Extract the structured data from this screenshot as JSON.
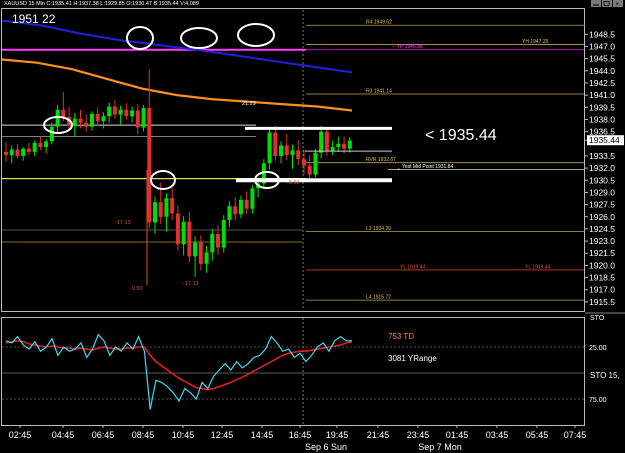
{
  "header": {
    "symbol_line": "XAUUSD 15 Min C:1935.41 H:1937.38 L:1929.85 O:1930.47 B:1935.44 V:4,089",
    "timer": "1951 22"
  },
  "window_controls": [
    "minimize",
    "restore",
    "close"
  ],
  "annotation": {
    "price_text": "< 1935.44"
  },
  "levels": [
    {
      "label": "R4 1949.62",
      "value": 1949.62,
      "color": "#e0c060"
    },
    {
      "label": "YH 1947.25",
      "value": 1947.25,
      "color": "#e0c060"
    },
    {
      "label": "-- YP 1946.88",
      "value": 1946.6,
      "color": "#ff40ff"
    },
    {
      "label": "R3 1941.14",
      "value": 1941.14,
      "color": "#e0c060"
    },
    {
      "label": "RVR 1932.67",
      "value": 1932.67,
      "color": "#e0c060"
    },
    {
      "label": "Yest Mid Point 1931.84",
      "value": 1931.84,
      "color": "#ffffff"
    },
    {
      "label": "L3 1924.20",
      "value": 1924.2,
      "color": "#e0c060"
    },
    {
      "label": "YL 1919.44",
      "value": 1919.44,
      "color": "#e05030"
    },
    {
      "label": "L4 1915.72",
      "value": 1915.72,
      "color": "#e0c060"
    }
  ],
  "candle_labels": [
    "21.29",
    "-17.13",
    "-9.50",
    "-17.13",
    "-8.62"
  ],
  "indicator_labels": {
    "td": "753 TD",
    "yrange": "3081 YRange",
    "sto_short": "STO",
    "sto_long": "STO 15,"
  },
  "colors": {
    "bull": "#00e000",
    "bear": "#e03030",
    "ma_slow": "#2020e0",
    "ma_fast": "#ff9020",
    "cyan": "#40d8f0",
    "red_line": "#e02020"
  },
  "chart_data": {
    "type": "candlestick",
    "symbol": "XAUUSD",
    "timeframe": "15 Min",
    "ohlc_current": {
      "open": 1930.47,
      "high": 1937.38,
      "low": 1929.85,
      "close": 1935.41,
      "bid": 1935.44,
      "volume": 4089
    },
    "yaxis_ticks": [
      1948.5,
      1947.0,
      1945.5,
      1944.0,
      1942.5,
      1941.0,
      1939.5,
      1938.0,
      1936.5,
      1935.44,
      1933.5,
      1932.0,
      1930.5,
      1929.0,
      1927.5,
      1926.0,
      1924.5,
      1923.0,
      1921.5,
      1920.0,
      1918.5,
      1917.0,
      1915.5
    ],
    "ylim": [
      1914.5,
      1951.5
    ],
    "xaxis_ticks": [
      "02:45",
      "04:45",
      "06:45",
      "08:45",
      "10:45",
      "12:45",
      "14:45",
      "16:45",
      "19:45",
      "21:45",
      "23:45",
      "01:45",
      "03:45",
      "05:45",
      "07:45"
    ],
    "xaxis_dates": [
      "Sep 6 Sun",
      "Sep 7 Mon"
    ],
    "candles": [
      {
        "o": 1934.0,
        "h": 1935.2,
        "l": 1932.8,
        "c": 1933.6
      },
      {
        "o": 1933.6,
        "h": 1934.8,
        "l": 1932.6,
        "c": 1934.3
      },
      {
        "o": 1934.3,
        "h": 1935.0,
        "l": 1933.2,
        "c": 1933.5
      },
      {
        "o": 1933.5,
        "h": 1934.6,
        "l": 1932.9,
        "c": 1934.4
      },
      {
        "o": 1934.4,
        "h": 1935.1,
        "l": 1933.6,
        "c": 1934.0
      },
      {
        "o": 1934.0,
        "h": 1935.4,
        "l": 1933.5,
        "c": 1935.1
      },
      {
        "o": 1935.1,
        "h": 1935.9,
        "l": 1934.2,
        "c": 1934.6
      },
      {
        "o": 1934.6,
        "h": 1935.6,
        "l": 1933.8,
        "c": 1935.3
      },
      {
        "o": 1935.3,
        "h": 1937.6,
        "l": 1934.9,
        "c": 1937.1
      },
      {
        "o": 1937.1,
        "h": 1939.8,
        "l": 1936.4,
        "c": 1939.2
      },
      {
        "o": 1939.2,
        "h": 1941.4,
        "l": 1937.8,
        "c": 1938.3
      },
      {
        "o": 1938.3,
        "h": 1939.6,
        "l": 1936.7,
        "c": 1937.2
      },
      {
        "o": 1937.2,
        "h": 1938.8,
        "l": 1936.0,
        "c": 1938.1
      },
      {
        "o": 1938.1,
        "h": 1939.2,
        "l": 1936.9,
        "c": 1937.6
      },
      {
        "o": 1937.6,
        "h": 1938.6,
        "l": 1936.5,
        "c": 1937.1
      },
      {
        "o": 1937.1,
        "h": 1939.0,
        "l": 1936.6,
        "c": 1938.7
      },
      {
        "o": 1938.7,
        "h": 1939.5,
        "l": 1937.3,
        "c": 1937.8
      },
      {
        "o": 1937.8,
        "h": 1938.9,
        "l": 1936.9,
        "c": 1938.4
      },
      {
        "o": 1938.4,
        "h": 1940.1,
        "l": 1937.6,
        "c": 1939.6
      },
      {
        "o": 1939.6,
        "h": 1940.4,
        "l": 1938.1,
        "c": 1938.6
      },
      {
        "o": 1938.6,
        "h": 1939.7,
        "l": 1937.4,
        "c": 1939.2
      },
      {
        "o": 1939.2,
        "h": 1940.0,
        "l": 1938.0,
        "c": 1938.4
      },
      {
        "o": 1938.4,
        "h": 1939.6,
        "l": 1937.6,
        "c": 1939.1
      },
      {
        "o": 1939.1,
        "h": 1939.9,
        "l": 1936.2,
        "c": 1937.0
      },
      {
        "o": 1937.0,
        "h": 1939.8,
        "l": 1936.5,
        "c": 1939.4
      },
      {
        "o": 1939.4,
        "h": 1944.2,
        "l": 1924.6,
        "c": 1925.3
      },
      {
        "o": 1925.3,
        "h": 1928.5,
        "l": 1923.9,
        "c": 1927.8
      },
      {
        "o": 1927.8,
        "h": 1930.2,
        "l": 1925.1,
        "c": 1926.0
      },
      {
        "o": 1926.0,
        "h": 1928.9,
        "l": 1924.2,
        "c": 1928.3
      },
      {
        "o": 1928.3,
        "h": 1929.6,
        "l": 1925.6,
        "c": 1926.4
      },
      {
        "o": 1926.4,
        "h": 1927.4,
        "l": 1921.8,
        "c": 1922.6
      },
      {
        "o": 1922.6,
        "h": 1926.1,
        "l": 1921.2,
        "c": 1925.4
      },
      {
        "o": 1925.4,
        "h": 1926.6,
        "l": 1920.4,
        "c": 1921.1
      },
      {
        "o": 1921.1,
        "h": 1923.6,
        "l": 1918.6,
        "c": 1922.8
      },
      {
        "o": 1922.8,
        "h": 1923.7,
        "l": 1919.4,
        "c": 1920.2
      },
      {
        "o": 1920.2,
        "h": 1922.4,
        "l": 1919.1,
        "c": 1921.6
      },
      {
        "o": 1921.6,
        "h": 1924.5,
        "l": 1920.6,
        "c": 1923.9
      },
      {
        "o": 1923.9,
        "h": 1925.0,
        "l": 1921.3,
        "c": 1922.2
      },
      {
        "o": 1922.2,
        "h": 1926.2,
        "l": 1921.6,
        "c": 1925.6
      },
      {
        "o": 1925.6,
        "h": 1927.9,
        "l": 1924.7,
        "c": 1927.3
      },
      {
        "o": 1927.3,
        "h": 1928.4,
        "l": 1925.5,
        "c": 1926.3
      },
      {
        "o": 1926.3,
        "h": 1928.6,
        "l": 1925.8,
        "c": 1928.1
      },
      {
        "o": 1928.1,
        "h": 1929.1,
        "l": 1926.3,
        "c": 1927.0
      },
      {
        "o": 1927.0,
        "h": 1929.9,
        "l": 1926.4,
        "c": 1929.5
      },
      {
        "o": 1929.5,
        "h": 1930.6,
        "l": 1928.4,
        "c": 1930.1
      },
      {
        "o": 1930.1,
        "h": 1933.1,
        "l": 1929.4,
        "c": 1932.6
      },
      {
        "o": 1932.6,
        "h": 1937.1,
        "l": 1931.8,
        "c": 1936.4
      },
      {
        "o": 1936.4,
        "h": 1937.2,
        "l": 1932.9,
        "c": 1933.5
      },
      {
        "o": 1933.5,
        "h": 1935.3,
        "l": 1932.6,
        "c": 1934.8
      },
      {
        "o": 1934.8,
        "h": 1936.2,
        "l": 1933.0,
        "c": 1933.6
      },
      {
        "o": 1933.6,
        "h": 1934.9,
        "l": 1931.9,
        "c": 1934.2
      },
      {
        "o": 1934.2,
        "h": 1935.5,
        "l": 1932.4,
        "c": 1933.1
      },
      {
        "o": 1933.1,
        "h": 1934.3,
        "l": 1931.2,
        "c": 1932.3
      },
      {
        "o": 1932.3,
        "h": 1933.6,
        "l": 1930.6,
        "c": 1931.2
      },
      {
        "o": 1931.2,
        "h": 1934.4,
        "l": 1930.9,
        "c": 1933.9
      },
      {
        "o": 1933.9,
        "h": 1937.2,
        "l": 1933.2,
        "c": 1936.5
      },
      {
        "o": 1936.5,
        "h": 1936.9,
        "l": 1933.5,
        "c": 1934.1
      },
      {
        "o": 1934.1,
        "h": 1935.4,
        "l": 1933.6,
        "c": 1934.6
      },
      {
        "o": 1934.6,
        "h": 1935.9,
        "l": 1934.0,
        "c": 1935.0
      },
      {
        "o": 1935.0,
        "h": 1935.9,
        "l": 1933.8,
        "c": 1934.4
      },
      {
        "o": 1934.4,
        "h": 1935.8,
        "l": 1933.9,
        "c": 1935.4
      }
    ],
    "ma_slow": [
      1950.2,
      1949.6,
      1948.6,
      1947.8,
      1947.2,
      1946.6,
      1945.9,
      1945.2,
      1944.5,
      1943.8
    ],
    "ma_fast": [
      1945.4,
      1945.0,
      1944.2,
      1943.0,
      1941.8,
      1941.0,
      1940.5,
      1940.2,
      1939.9,
      1939.6,
      1939.1
    ],
    "stochastic": {
      "ylim": [
        0,
        100
      ],
      "levels": [
        25.0,
        75.0
      ],
      "main": [
        80,
        78,
        84,
        76,
        72,
        79,
        70,
        74,
        82,
        66,
        74,
        70,
        72,
        78,
        64,
        72,
        86,
        80,
        66,
        74,
        70,
        78,
        72,
        84,
        70,
        14,
        42,
        40,
        36,
        30,
        22,
        34,
        30,
        24,
        40,
        34,
        46,
        52,
        58,
        52,
        60,
        54,
        58,
        64,
        66,
        72,
        84,
        78,
        70,
        72,
        64,
        68,
        60,
        66,
        74,
        78,
        70,
        80,
        84,
        80,
        80
      ],
      "signal": [
        78,
        79,
        80,
        79,
        77,
        76,
        75,
        74,
        75,
        74,
        73,
        73,
        72,
        73,
        72,
        71,
        73,
        74,
        73,
        72,
        72,
        73,
        73,
        74,
        74,
        66,
        60,
        56,
        52,
        48,
        44,
        41,
        38,
        35,
        34,
        33,
        34,
        36,
        38,
        40,
        43,
        45,
        48,
        51,
        54,
        57,
        60,
        63,
        66,
        68,
        69,
        70,
        70,
        71,
        72,
        73,
        74,
        75,
        76,
        78,
        79
      ]
    }
  }
}
